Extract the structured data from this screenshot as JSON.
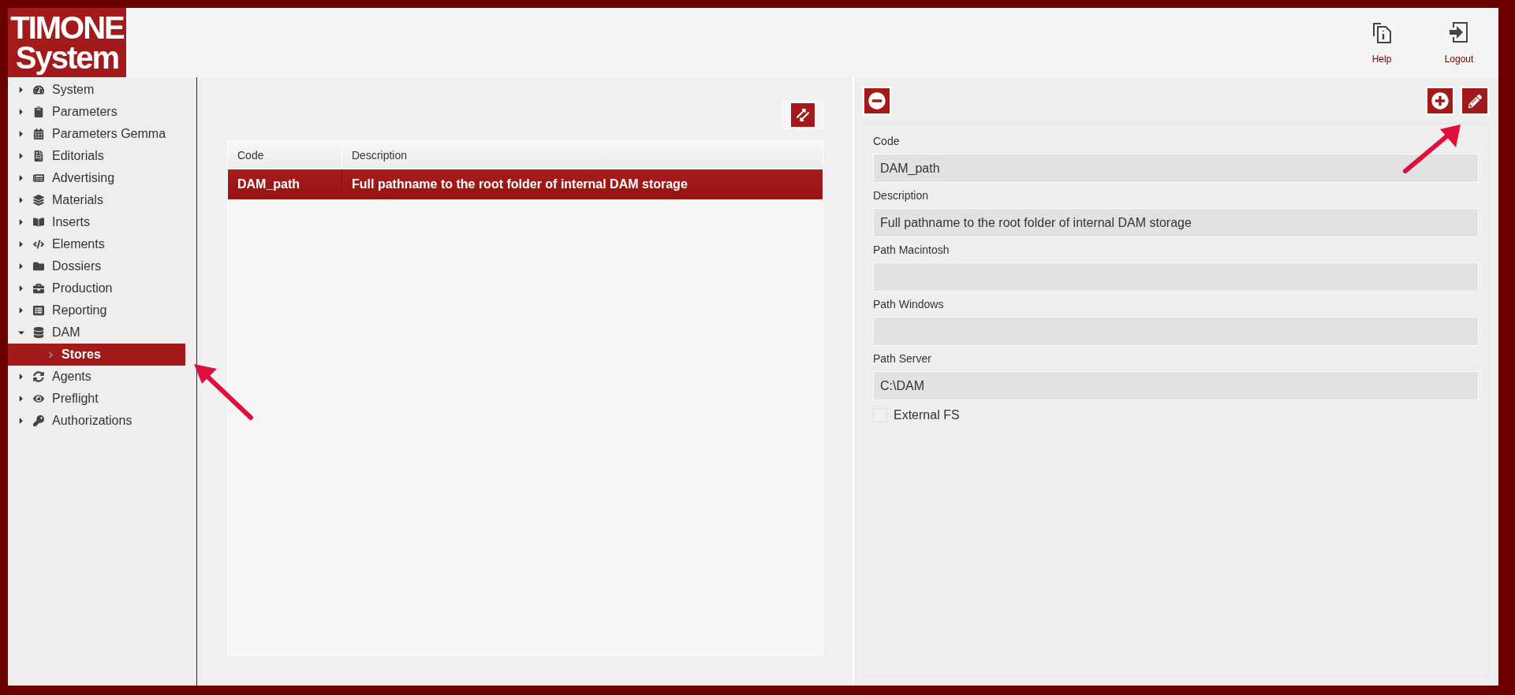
{
  "logo": {
    "line_1": "TIMONE",
    "line_2": "System"
  },
  "header_actions": [
    {
      "kind": "help",
      "label": "Help"
    },
    {
      "kind": "logout",
      "label": "Logout"
    }
  ],
  "sidebar": {
    "items": [
      {
        "label": "System",
        "expanded": false,
        "selected": false
      },
      {
        "label": "Parameters",
        "expanded": false,
        "selected": false
      },
      {
        "label": "Parameters Gemma",
        "expanded": false,
        "selected": false
      },
      {
        "label": "Editorials",
        "expanded": false,
        "selected": false
      },
      {
        "label": "Advertising",
        "expanded": false,
        "selected": false
      },
      {
        "label": "Materials",
        "expanded": false,
        "selected": false
      },
      {
        "label": "Inserts",
        "expanded": false,
        "selected": false
      },
      {
        "label": "Elements",
        "expanded": false,
        "selected": false
      },
      {
        "label": "Dossiers",
        "expanded": false,
        "selected": false
      },
      {
        "label": "Production",
        "expanded": false,
        "selected": false
      },
      {
        "label": "Reporting",
        "expanded": false,
        "selected": false
      },
      {
        "label": "DAM",
        "expanded": true,
        "selected": false,
        "children": [
          {
            "label": "Stores",
            "selected": true
          }
        ]
      },
      {
        "label": "Agents",
        "expanded": false,
        "selected": false
      },
      {
        "label": "Preflight",
        "expanded": false,
        "selected": false
      },
      {
        "label": "Authorizations",
        "expanded": false,
        "selected": false
      }
    ]
  },
  "table": {
    "columns": [
      "Code",
      "Description"
    ],
    "rows": [
      {
        "cells": [
          "DAM_path",
          "Full pathname to the root folder of internal DAM storage"
        ],
        "selected": true
      }
    ]
  },
  "form": {
    "fields": [
      {
        "label": "Code",
        "value": "DAM_path"
      },
      {
        "label": "Description",
        "value": "Full pathname to the root folder of internal DAM storage"
      },
      {
        "label": "Path Macintosh"
      },
      {
        "label": "Path Windows"
      },
      {
        "label": "Path Server",
        "value": "C:\\DAM"
      }
    ],
    "checkbox": {
      "label": "External FS",
      "checked": false
    }
  }
}
